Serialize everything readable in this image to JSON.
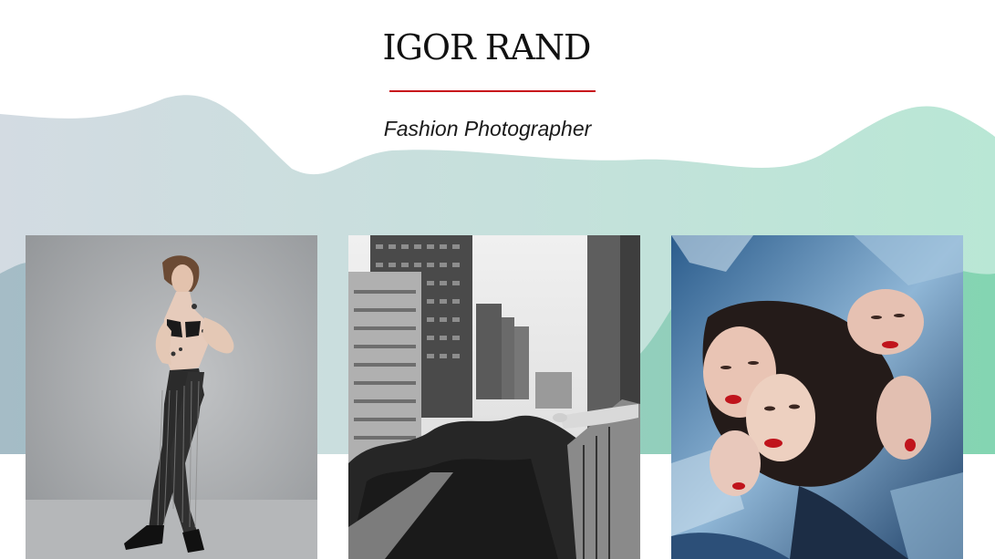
{
  "header": {
    "title": "IGOR RAND",
    "subtitle": "Fashion Photographer"
  },
  "colors": {
    "accent_rule": "#c8121b",
    "wave_back_left": "#d3dde3",
    "wave_back_right": "#bfe6d6",
    "wave_front_left": "#a7bfc7",
    "wave_front_right": "#86d6b3"
  },
  "gallery": {
    "photos": [
      {
        "subject": "model in fishnet tights, tattoos, grey studio backdrop"
      },
      {
        "subject": "black and white city towers, legs over balcony"
      },
      {
        "subject": "mirrored faces with red lips, blue metallic foil"
      }
    ]
  }
}
